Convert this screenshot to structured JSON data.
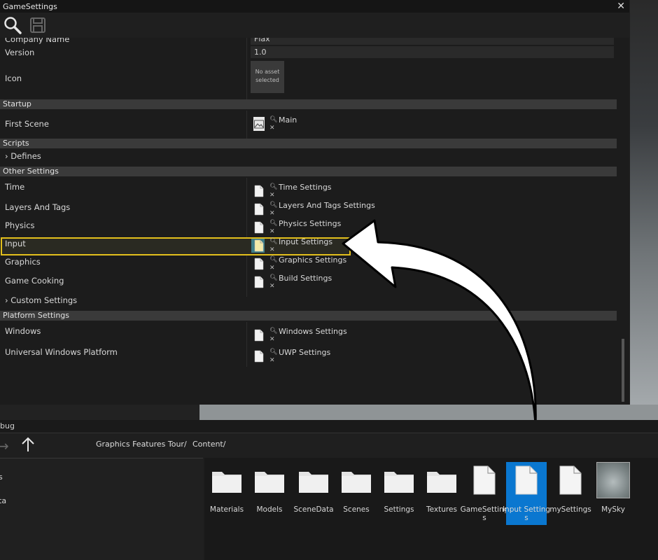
{
  "window": {
    "title": "GameSettings",
    "close_glyph": "✕"
  },
  "toolbar": {
    "search_icon": "search-icon",
    "save_icon": "save-icon"
  },
  "general": {
    "company_name_label": "Company Name",
    "company_name_value": "Flax",
    "version_label": "Version",
    "version_value": "1.0",
    "icon_label": "Icon",
    "icon_empty_text": "No asset selected"
  },
  "sections": {
    "startup": "Startup",
    "scripts": "Scripts",
    "other": "Other Settings",
    "platform": "Platform Settings"
  },
  "startup": {
    "first_scene_label": "First Scene",
    "first_scene_value": "Main"
  },
  "scripts": {
    "defines_label": "Defines"
  },
  "other": {
    "rows": [
      {
        "label": "Time",
        "value": "Time Settings"
      },
      {
        "label": "Layers And Tags",
        "value": "Layers And Tags Settings"
      },
      {
        "label": "Physics",
        "value": "Physics Settings"
      },
      {
        "label": "Input",
        "value": "Input Settings"
      },
      {
        "label": "Graphics",
        "value": "Graphics Settings"
      },
      {
        "label": "Game Cooking",
        "value": "Build Settings"
      }
    ],
    "custom_label": "Custom Settings"
  },
  "platform": {
    "rows": [
      {
        "label": "Windows",
        "value": "Windows Settings"
      },
      {
        "label": "Universal Windows Platform",
        "value": "UWP Settings"
      }
    ]
  },
  "content": {
    "debug_tab": "bug",
    "breadcrumbs": [
      "Graphics Features Tour/",
      "Content/"
    ],
    "tree_items": [
      "s",
      "ta"
    ],
    "items": [
      {
        "name": "Materials",
        "kind": "folder"
      },
      {
        "name": "Models",
        "kind": "folder"
      },
      {
        "name": "SceneData",
        "kind": "folder"
      },
      {
        "name": "Scenes",
        "kind": "folder"
      },
      {
        "name": "Settings",
        "kind": "folder"
      },
      {
        "name": "Textures",
        "kind": "folder"
      },
      {
        "name": "GameSettings",
        "kind": "file"
      },
      {
        "name": "Input Settings",
        "kind": "file",
        "selected": true
      },
      {
        "name": "mySettings",
        "kind": "file"
      },
      {
        "name": "MySky",
        "kind": "sky"
      }
    ]
  },
  "colors": {
    "highlight": "#e3c01c",
    "selection": "#0a77d0"
  }
}
